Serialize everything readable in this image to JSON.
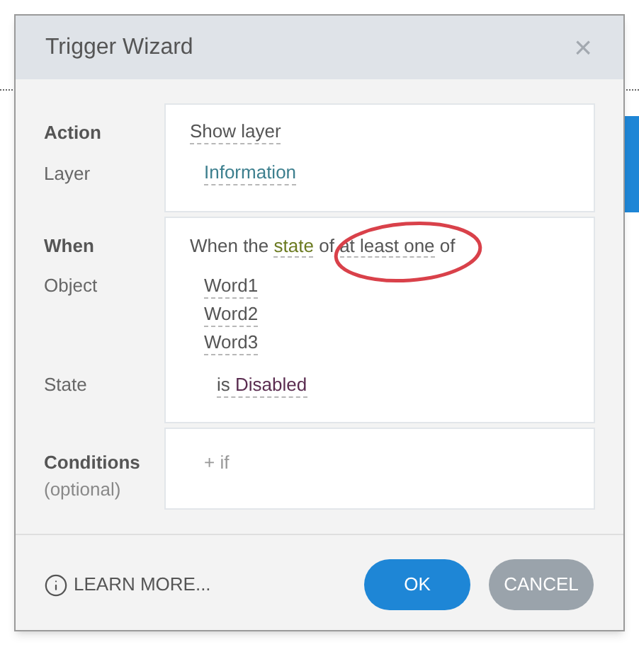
{
  "dialog": {
    "title": "Trigger Wizard",
    "close": "×"
  },
  "action": {
    "label": "Action",
    "value": "Show layer"
  },
  "layer": {
    "label": "Layer",
    "value": "Information"
  },
  "when": {
    "label": "When",
    "highlighted": true,
    "sentence": [
      {
        "kind": "text",
        "text": "When the"
      },
      {
        "kind": "state-option",
        "text": "state"
      },
      {
        "kind": "text",
        "text": "of"
      },
      {
        "kind": "option",
        "text": "at least one"
      },
      {
        "kind": "text",
        "text": "of"
      }
    ]
  },
  "object": {
    "label": "Object",
    "items": [
      "Word1",
      "Word2",
      "Word3"
    ]
  },
  "state": {
    "label": "State",
    "prefix": "is",
    "value": "Disabled"
  },
  "conditions": {
    "label": "Conditions",
    "hint": "(optional)",
    "add": "+ if"
  },
  "footer": {
    "learn_more": "LEARN MORE...",
    "buttons": [
      {
        "label": "OK",
        "kind": "primary"
      },
      {
        "label": "CANCEL",
        "kind": "secondary"
      }
    ]
  }
}
